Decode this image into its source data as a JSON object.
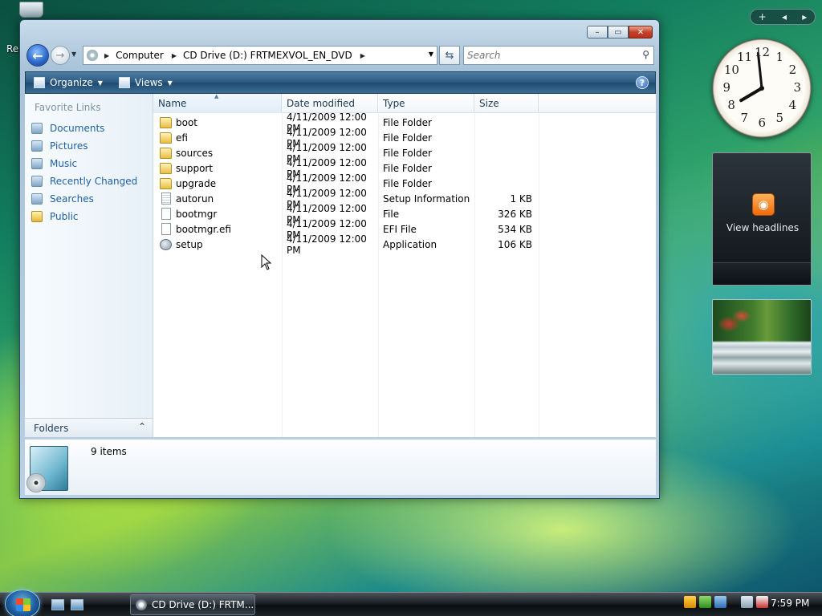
{
  "desktop": {
    "recycle_label": "Re"
  },
  "window": {
    "controls": {
      "minimize": "–",
      "maximize": "▭",
      "close": "✕"
    },
    "address": {
      "crumbs": [
        "Computer",
        "CD Drive (D:) FRTMEXVOL_EN_DVD"
      ]
    },
    "search": {
      "placeholder": "Search"
    },
    "toolbar": {
      "organize": "Organize",
      "views": "Views",
      "help": "?"
    },
    "nav": {
      "heading": "Favorite Links",
      "items": [
        {
          "label": "Documents",
          "icon": "documents-icon"
        },
        {
          "label": "Pictures",
          "icon": "pictures-icon"
        },
        {
          "label": "Music",
          "icon": "music-icon"
        },
        {
          "label": "Recently Changed",
          "icon": "recently-changed-icon"
        },
        {
          "label": "Searches",
          "icon": "searches-icon"
        },
        {
          "label": "Public",
          "icon": "folder-icon"
        }
      ],
      "folders_label": "Folders"
    },
    "columns": [
      "Name",
      "Date modified",
      "Type",
      "Size"
    ],
    "files": [
      {
        "name": "boot",
        "date": "4/11/2009 12:00 PM",
        "type": "File Folder",
        "size": "",
        "icon": "folder"
      },
      {
        "name": "efi",
        "date": "4/11/2009 12:00 PM",
        "type": "File Folder",
        "size": "",
        "icon": "folder"
      },
      {
        "name": "sources",
        "date": "4/11/2009 12:00 PM",
        "type": "File Folder",
        "size": "",
        "icon": "folder"
      },
      {
        "name": "support",
        "date": "4/11/2009 12:00 PM",
        "type": "File Folder",
        "size": "",
        "icon": "folder"
      },
      {
        "name": "upgrade",
        "date": "4/11/2009 12:00 PM",
        "type": "File Folder",
        "size": "",
        "icon": "folder"
      },
      {
        "name": "autorun",
        "date": "4/11/2009 12:00 PM",
        "type": "Setup Information",
        "size": "1 KB",
        "icon": "inf"
      },
      {
        "name": "bootmgr",
        "date": "4/11/2009 12:00 PM",
        "type": "File",
        "size": "326 KB",
        "icon": "file"
      },
      {
        "name": "bootmgr.efi",
        "date": "4/11/2009 12:00 PM",
        "type": "EFI File",
        "size": "534 KB",
        "icon": "file"
      },
      {
        "name": "setup",
        "date": "4/11/2009 12:00 PM",
        "type": "Application",
        "size": "106 KB",
        "icon": "app"
      }
    ],
    "details": {
      "count": "9 items"
    }
  },
  "gadgets": {
    "sidebar_controls": [
      "+",
      "◂",
      "▸"
    ],
    "clock": {
      "numbers": [
        "12",
        "1",
        "2",
        "3",
        "4",
        "5",
        "6",
        "7",
        "8",
        "9",
        "10",
        "11"
      ],
      "hour": 7,
      "minute": 59
    },
    "feed": {
      "label": "View headlines"
    }
  },
  "taskbar": {
    "task": "CD Drive (D:) FRTM...",
    "time": "7:59 PM",
    "colors": {
      "accent": "#2a587e"
    }
  }
}
